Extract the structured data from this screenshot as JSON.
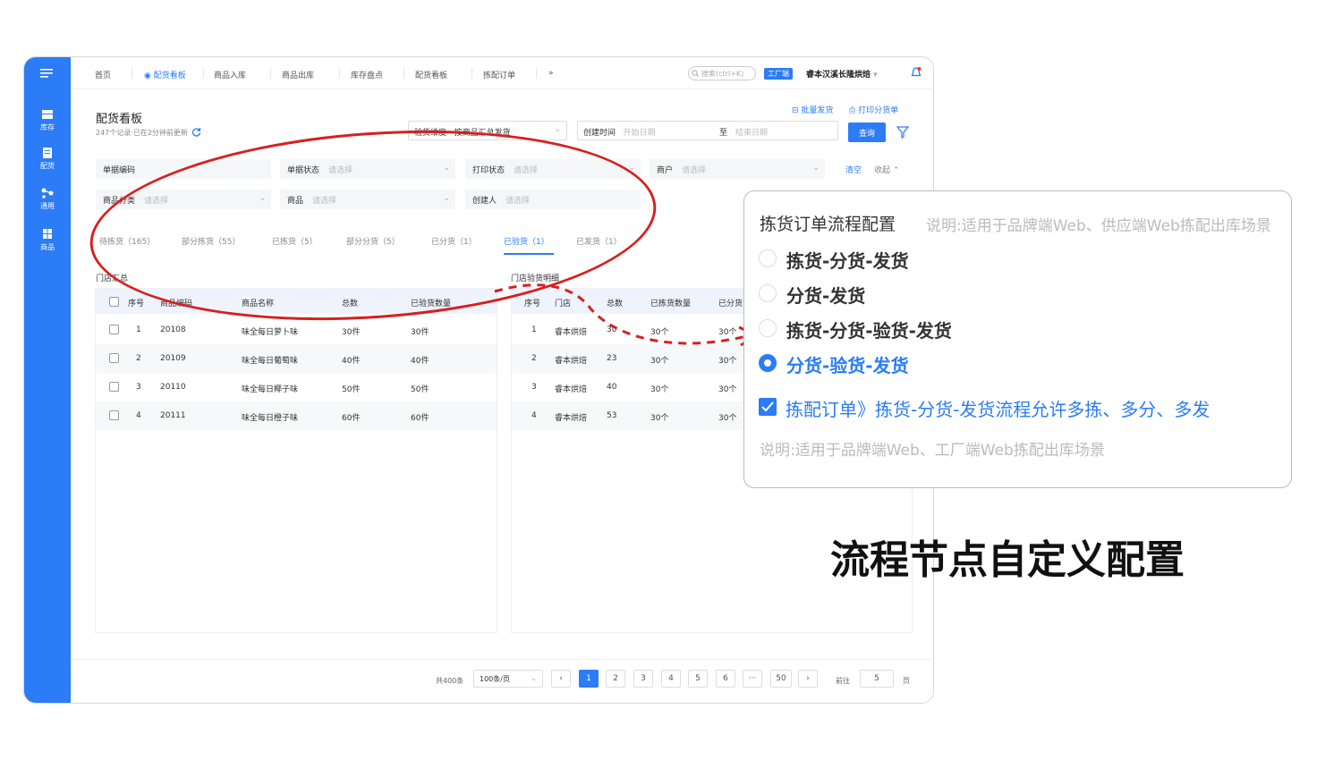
{
  "sidebar": {
    "items": [
      {
        "label": "库存",
        "icon": "inventory-icon"
      },
      {
        "label": "配货",
        "icon": "distribution-icon"
      },
      {
        "label": "通用",
        "icon": "share-icon"
      },
      {
        "label": "商品",
        "icon": "grid-icon"
      }
    ]
  },
  "topbar": {
    "tabs": [
      "首页",
      "配货看板",
      "商品入库",
      "商品出库",
      "库存盘点",
      "配货看板",
      "拣配订单"
    ],
    "more": "»",
    "search_placeholder": "搜索(ctrl+K)",
    "badge": "工厂端",
    "store": "睿本汉溪长隆烘焙",
    "store_caret": "▾"
  },
  "header": {
    "title": "配货看板",
    "subtitle": "247个记录·已在2分钟前更新",
    "batch_ship": "批量发货",
    "print_slip": "打印分货单",
    "dimension_label": "验货维度",
    "dimension_value": "按商品汇总发货",
    "created_label": "创建时间",
    "start_placeholder": "开始日期",
    "to": "至",
    "end_placeholder": "结束日期",
    "query": "查询"
  },
  "filters": {
    "doc_code": "单据编码",
    "doc_status": "单据状态",
    "print_status": "打印状态",
    "merchant": "商户",
    "category": "商品分类",
    "product": "商品",
    "creator": "创建人",
    "placeholder": "请选择",
    "clear": "清空",
    "collapse": "收起"
  },
  "status_tabs": [
    "待拣货（165）",
    "部分拣货（55）",
    "已拣货（5）",
    "部分分货（5）",
    "已分货（1）",
    "已验货（1）",
    "已发货（1）"
  ],
  "left_panel": {
    "title": "门店汇总",
    "headers": [
      "序号",
      "商品编码",
      "商品名称",
      "总数",
      "已验货数量"
    ],
    "rows": [
      [
        "1",
        "20108",
        "味全每日萝卜味",
        "30件",
        "30件"
      ],
      [
        "2",
        "20109",
        "味全每日葡萄味",
        "40件",
        "40件"
      ],
      [
        "3",
        "20110",
        "味全每日椰子味",
        "50件",
        "50件"
      ],
      [
        "4",
        "20111",
        "味全每日橙子味",
        "60件",
        "60件"
      ]
    ]
  },
  "right_panel": {
    "title": "门店验货明细",
    "headers": [
      "序号",
      "门店",
      "总数",
      "已拣货数量",
      "已分货"
    ],
    "rows": [
      [
        "1",
        "睿本烘焙",
        "30",
        "30个",
        "30个"
      ],
      [
        "2",
        "睿本烘焙",
        "23",
        "30个",
        "30个"
      ],
      [
        "3",
        "睿本烘焙",
        "40",
        "30个",
        "30个"
      ],
      [
        "4",
        "睿本烘焙",
        "53",
        "30个",
        "30个"
      ]
    ]
  },
  "pagination": {
    "total": "共400条",
    "per_page": "100条/页",
    "pages": [
      "1",
      "2",
      "3",
      "4",
      "5",
      "6",
      "···",
      "50"
    ],
    "current": "1",
    "goto_label": "前往",
    "goto_value": "5",
    "page_suffix": "页"
  },
  "popup": {
    "title": "拣货订单流程配置",
    "note": "说明:适用于品牌端Web、供应端Web拣配出库场景",
    "options": [
      "拣货-分货-发货",
      "分货-发货",
      "拣货-分货-验货-发货",
      "分货-验货-发货"
    ],
    "selected_index": 3,
    "checkbox_label": "拣配订单》拣货-分货-发货流程允许多拣、多分、多发",
    "checkbox_checked": true,
    "note2": "说明:适用于品牌端Web、工厂端Web拣配出库场景"
  },
  "caption": "流程节点自定义配置",
  "colors": {
    "primary": "#2b7cf6",
    "annotation": "#d81f1f"
  }
}
